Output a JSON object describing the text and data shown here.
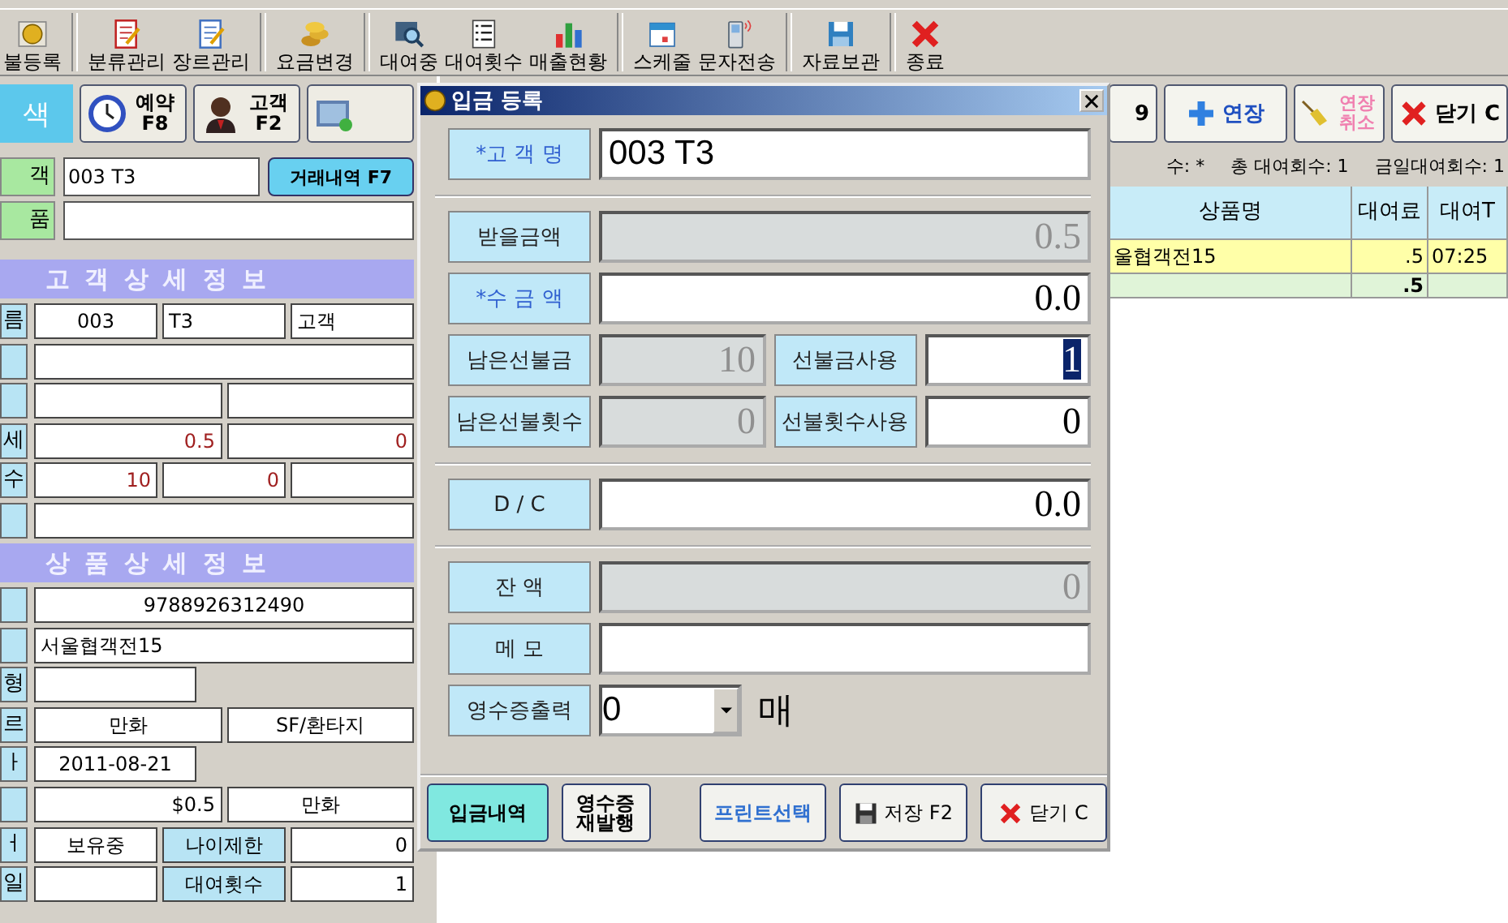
{
  "toolbar": {
    "groups": [
      [
        {
          "label": "불등록",
          "kind": "coin"
        }
      ],
      [
        {
          "label": "분류관리",
          "kind": "notepad"
        },
        {
          "label": "장르관리",
          "kind": "memo"
        }
      ],
      [
        {
          "label": "요금변경",
          "kind": "coins"
        }
      ],
      [
        {
          "label": "대여중",
          "kind": "film"
        },
        {
          "label": "대여횟수",
          "kind": "list"
        },
        {
          "label": "매출현황",
          "kind": "chart"
        }
      ],
      [
        {
          "label": "스케줄",
          "kind": "calendar"
        },
        {
          "label": "문자전송",
          "kind": "phone"
        }
      ],
      [
        {
          "label": "자료보관",
          "kind": "disk"
        }
      ],
      [
        {
          "label": "종료",
          "kind": "cross"
        }
      ]
    ]
  },
  "search_tab": "색",
  "left_buttons": [
    {
      "label": "예약 F8",
      "kind": "clock"
    },
    {
      "label": "고객 F2",
      "kind": "person"
    },
    {
      "kind": "photo"
    }
  ],
  "lookup": [
    {
      "label": "객",
      "value": "003 T3",
      "button": "거래내역 F7"
    },
    {
      "label": "품"
    }
  ],
  "sections": [
    {
      "title": "고 객 상 세 정 보",
      "rows": [
        {
          "label": "름",
          "kind": "full",
          "cells": [
            {
              "kind": "code",
              "text": "003"
            },
            {
              "kind": "text",
              "text": "T3"
            },
            {
              "kind": "text",
              "text": "고객"
            }
          ]
        },
        {
          "kind": "full",
          "cells": [
            {
              "kind": "text"
            }
          ]
        },
        {
          "kind": "full",
          "cells": [
            {
              "kind": "text"
            },
            {
              "kind": "text"
            }
          ]
        },
        {
          "label": "세",
          "kind": "full",
          "cells": [
            {
              "kind": "amount",
              "text": "0.5"
            },
            {
              "kind": "amount",
              "text": "0"
            }
          ]
        },
        {
          "label": "수",
          "kind": "full",
          "cells": [
            {
              "kind": "amount",
              "text": "10"
            },
            {
              "kind": "amount",
              "text": "0"
            },
            {
              "kind": "text"
            }
          ]
        },
        {
          "kind": "full",
          "cells": [
            {
              "kind": "text"
            }
          ]
        }
      ]
    },
    {
      "title": "상 품 상 세 정 보",
      "rows": [
        {
          "kind": "full",
          "cells": [
            {
              "kind": "code",
              "text": "9788926312490"
            }
          ]
        },
        {
          "kind": "full",
          "cells": [
            {
              "kind": "text",
              "text": "서울협객전15"
            }
          ]
        },
        {
          "label": "형",
          "kind": "half",
          "cells": [
            {
              "kind": "text"
            }
          ]
        },
        {
          "label": "르",
          "kind": "full",
          "cells": [
            {
              "kind": "code",
              "text": "만화"
            },
            {
              "kind": "code",
              "text": "SF/환타지"
            }
          ]
        },
        {
          "label": "ㅏ",
          "kind": "half",
          "cells": [
            {
              "kind": "code",
              "text": "2011-08-21"
            }
          ]
        },
        {
          "kind": "full",
          "cells": [
            {
              "kind": "price",
              "text": "$0.5"
            },
            {
              "kind": "code",
              "text": "만화"
            }
          ]
        },
        {
          "label": "ㅓ",
          "kind": "full",
          "cells": [
            {
              "kind": "code",
              "text": "보유중"
            },
            {
              "kind": "label",
              "text": "나이제한"
            },
            {
              "kind": "price",
              "text": "0"
            }
          ]
        },
        {
          "label": "일",
          "kind": "full",
          "cells": [
            {
              "kind": "text"
            },
            {
              "kind": "label",
              "text": "대여횟수"
            },
            {
              "kind": "price",
              "text": "1"
            }
          ]
        }
      ]
    }
  ],
  "right_buttons": [
    {
      "label": "9",
      "kind": "partial"
    },
    {
      "label": "연장",
      "kind": "extend"
    },
    {
      "label": "연장 취소",
      "kind": "cancel"
    },
    {
      "label": "닫기 C",
      "kind": "close"
    }
  ],
  "status": [
    {
      "text": "수: *"
    },
    {
      "text": "총 대여회수: 1"
    },
    {
      "text": "금일대여회수: 1"
    }
  ],
  "table": {
    "columns": [
      "상품명",
      "대여료",
      "대여T"
    ],
    "rows": [
      {
        "cells": [
          "울협객전15",
          ".5",
          "07:25"
        ]
      }
    ],
    "total_fee": ".5"
  },
  "dialog": {
    "title": "입금 등록",
    "sections": [
      {
        "rows": [
          [
            {
              "label": "*고 객 명",
              "required": true,
              "kind": "text",
              "value": "003 T3",
              "disabled": false,
              "selected": false
            }
          ]
        ]
      },
      {
        "rows": [
          [
            {
              "label": "받을금액",
              "required": false,
              "kind": "number",
              "value": "0.5",
              "disabled": true,
              "selected": false
            }
          ],
          [
            {
              "label": "*수 금 액",
              "required": true,
              "kind": "number",
              "value": "0.0",
              "disabled": false,
              "selected": false
            }
          ],
          [
            {
              "label": "남은선불금",
              "required": false,
              "kind": "number",
              "value": "10",
              "disabled": true,
              "selected": false
            },
            {
              "label": "선불금사용",
              "required": false,
              "kind": "number",
              "value": "1",
              "disabled": false,
              "selected": true
            }
          ],
          [
            {
              "label": "남은선불횟수",
              "required": false,
              "kind": "number",
              "value": "0",
              "disabled": true,
              "selected": false
            },
            {
              "label": "선불횟수사용",
              "required": false,
              "kind": "number",
              "value": "0",
              "disabled": false,
              "selected": false
            }
          ]
        ]
      },
      {
        "rows": [
          [
            {
              "label": "D / C",
              "required": false,
              "kind": "number",
              "value": "0.0",
              "disabled": false,
              "selected": false
            }
          ]
        ]
      },
      {
        "rows": [
          [
            {
              "label": "잔 액",
              "required": false,
              "kind": "number",
              "value": "0",
              "disabled": true,
              "selected": false
            }
          ],
          [
            {
              "label": "메 모",
              "required": false,
              "kind": "text",
              "disabled": false,
              "selected": false
            }
          ],
          [
            {
              "label": "영수증출력",
              "required": false,
              "kind": "dropdown",
              "value": "0",
              "unit": "매",
              "disabled": false,
              "selected": false
            }
          ]
        ]
      }
    ],
    "buttons": [
      {
        "label": "입금내역",
        "kind": "history"
      },
      {
        "label": "영수증 재발행",
        "kind": "reissue"
      },
      {
        "label": "프린트선택",
        "kind": "print"
      },
      {
        "label": "저장 F2",
        "kind": "save"
      },
      {
        "label": "닫기 C",
        "kind": "close"
      }
    ]
  }
}
